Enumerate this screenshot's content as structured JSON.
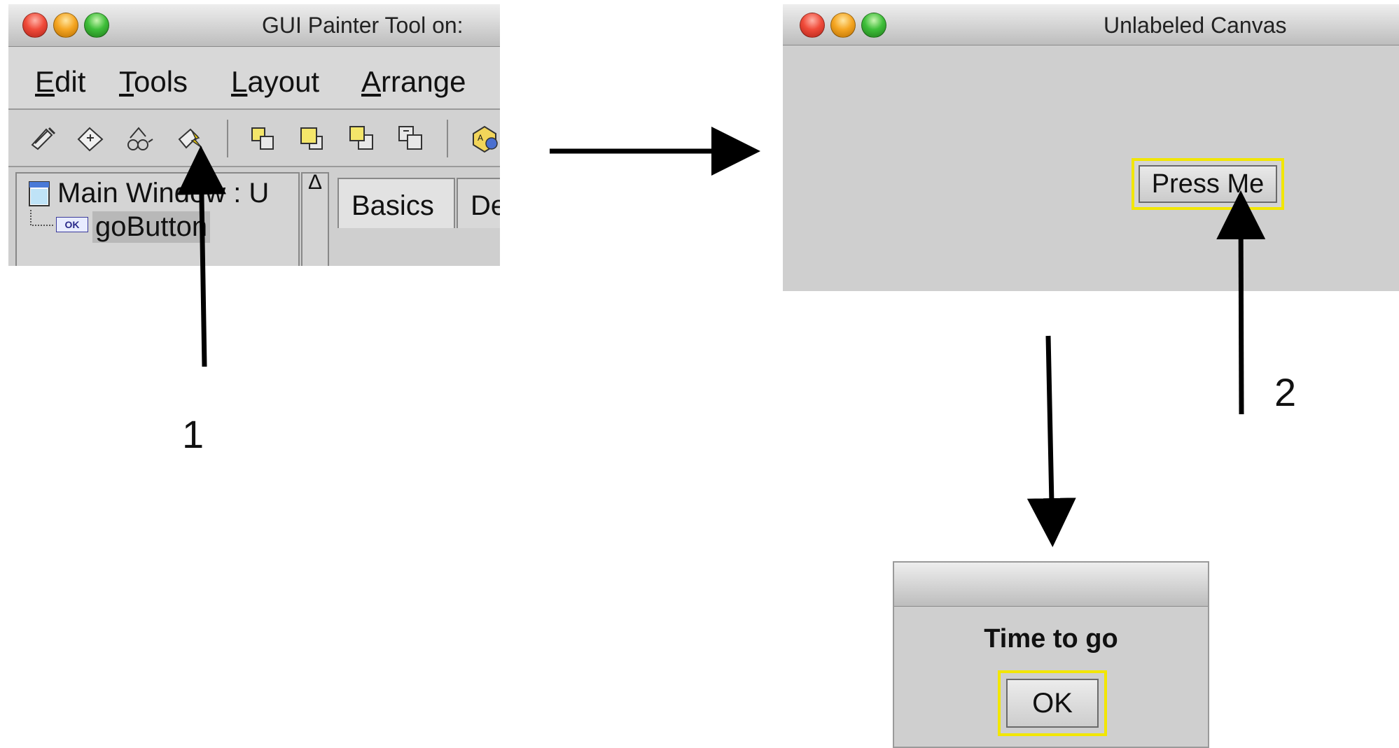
{
  "painter_window": {
    "title": "GUI Painter Tool on:",
    "menu": [
      {
        "key": "E",
        "rest": "dit"
      },
      {
        "key": "T",
        "rest": "ools"
      },
      {
        "key": "L",
        "rest": "ayout"
      },
      {
        "key": "A",
        "rest": "rrange"
      }
    ],
    "tree": {
      "root_label": "Main Window : U",
      "child_badge": "OK",
      "child_label": "goButton"
    },
    "tabs": [
      "Basics",
      "De"
    ],
    "scroll_glyph": "Δ"
  },
  "canvas_window": {
    "title": "Unlabeled Canvas",
    "button_label": "Press Me"
  },
  "dialog": {
    "message": "Time to go",
    "ok_label": "OK"
  },
  "steps": {
    "step1": "1",
    "step2": "2"
  },
  "colors": {
    "highlight_border": "#f2e600",
    "window_bg": "#cfcfcf",
    "arrow": "#000000"
  }
}
